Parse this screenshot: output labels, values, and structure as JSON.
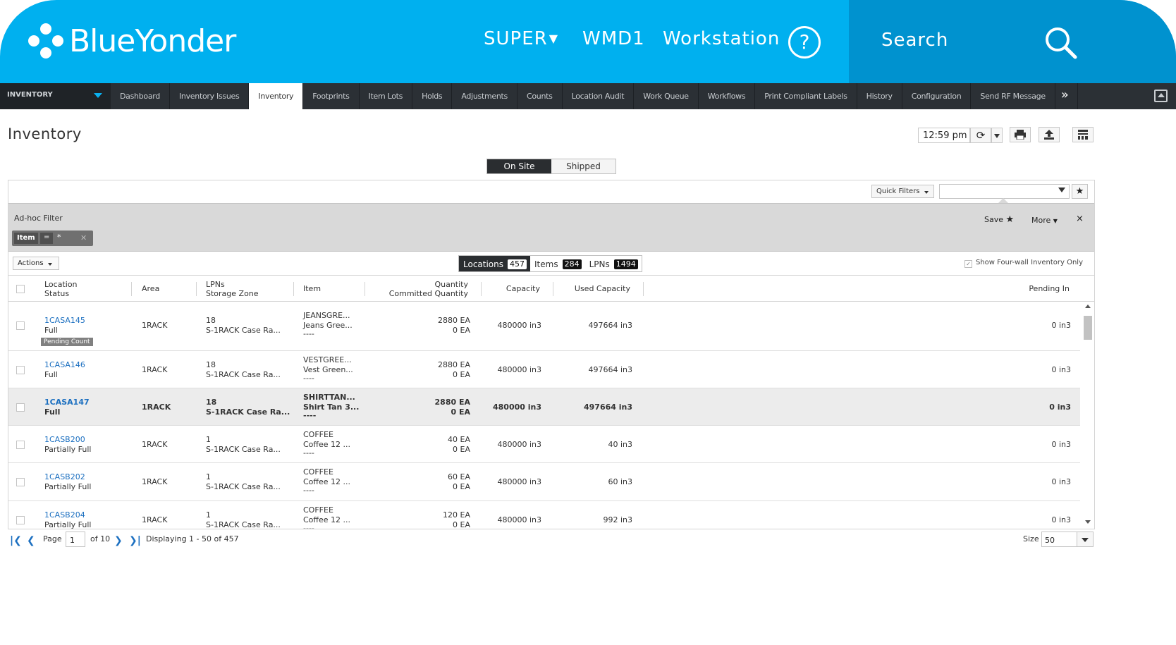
{
  "header": {
    "brand": "BlueYonder",
    "user": "SUPER",
    "warehouse": "WMD1",
    "context": "Workstation",
    "help": "?",
    "search_label": "Search"
  },
  "nav": {
    "module": "INVENTORY",
    "tabs": [
      "Dashboard",
      "Inventory Issues",
      "Inventory",
      "Footprints",
      "Item Lots",
      "Holds",
      "Adjustments",
      "Counts",
      "Location Audit",
      "Work Queue",
      "Workflows",
      "Print Compliant Labels",
      "History",
      "Configuration",
      "Send RF Message"
    ],
    "active_tab": "Inventory",
    "more": "»"
  },
  "page": {
    "title": "Inventory",
    "time": "12:59 pm"
  },
  "toggle": {
    "on_site": "On Site",
    "shipped": "Shipped",
    "selected": "On Site"
  },
  "filters": {
    "quick_filters": "Quick Filters",
    "adhoc_title": "Ad-hoc Filter",
    "save": "Save",
    "more": "More",
    "close": "×",
    "chip": {
      "field": "Item",
      "op": "=",
      "value": "*"
    }
  },
  "toolbar": {
    "actions": "Actions",
    "segments": [
      {
        "label": "Locations",
        "count": "457"
      },
      {
        "label": "Items",
        "count": "284"
      },
      {
        "label": "LPNs",
        "count": "1494"
      }
    ],
    "four_wall": "Show Four-wall Inventory Only",
    "four_wall_checked": true
  },
  "columns": {
    "location": "Location",
    "status": "Status",
    "area": "Area",
    "lpns": "LPNs",
    "storage_zone": "Storage Zone",
    "item": "Item",
    "quantity": "Quantity",
    "committed": "Committed Quantity",
    "capacity": "Capacity",
    "used": "Used Capacity",
    "pending": "Pending In"
  },
  "rows": [
    {
      "location": "1CASA145",
      "status": "Full",
      "badge": "Pending Count",
      "area": "1RACK",
      "lpns": "18",
      "zone": "S-1RACK Case Ra...",
      "item1": "JEANSGRE...",
      "item2": "Jeans Gree...",
      "item3": "----",
      "qty": "2880 EA",
      "committed": "0 EA",
      "capacity": "480000 in3",
      "used": "497664 in3",
      "pending": "0 in3",
      "selected": false
    },
    {
      "location": "1CASA146",
      "status": "Full",
      "badge": "",
      "area": "1RACK",
      "lpns": "18",
      "zone": "S-1RACK Case Ra...",
      "item1": "VESTGREE...",
      "item2": "Vest Green...",
      "item3": "----",
      "qty": "2880 EA",
      "committed": "0 EA",
      "capacity": "480000 in3",
      "used": "497664 in3",
      "pending": "0 in3",
      "selected": false
    },
    {
      "location": "1CASA147",
      "status": "Full",
      "badge": "",
      "area": "1RACK",
      "lpns": "18",
      "zone": "S-1RACK Case Ra...",
      "item1": "SHIRTTAN...",
      "item2": "Shirt Tan 3...",
      "item3": "----",
      "qty": "2880 EA",
      "committed": "0 EA",
      "capacity": "480000 in3",
      "used": "497664 in3",
      "pending": "0 in3",
      "selected": true
    },
    {
      "location": "1CASB200",
      "status": "Partially Full",
      "badge": "",
      "area": "1RACK",
      "lpns": "1",
      "zone": "S-1RACK Case Ra...",
      "item1": "COFFEE",
      "item2": "Coffee 12 ...",
      "item3": "----",
      "qty": "40 EA",
      "committed": "0 EA",
      "capacity": "480000 in3",
      "used": "40 in3",
      "pending": "0 in3",
      "selected": false
    },
    {
      "location": "1CASB202",
      "status": "Partially Full",
      "badge": "",
      "area": "1RACK",
      "lpns": "1",
      "zone": "S-1RACK Case Ra...",
      "item1": "COFFEE",
      "item2": "Coffee 12 ...",
      "item3": "----",
      "qty": "60 EA",
      "committed": "0 EA",
      "capacity": "480000 in3",
      "used": "60 in3",
      "pending": "0 in3",
      "selected": false
    },
    {
      "location": "1CASB204",
      "status": "Partially Full",
      "badge": "",
      "area": "1RACK",
      "lpns": "1",
      "zone": "S-1RACK Case Ra...",
      "item1": "COFFEE",
      "item2": "Coffee 12 ...",
      "item3": "----",
      "qty": "120 EA",
      "committed": "0 EA",
      "capacity": "480000 in3",
      "used": "992 in3",
      "pending": "0 in3",
      "selected": false
    }
  ],
  "pager": {
    "page_label": "Page",
    "page": "1",
    "of": "of 10",
    "displaying": "Displaying 1 - 50 of 457",
    "size_label": "Size",
    "size": "50"
  }
}
